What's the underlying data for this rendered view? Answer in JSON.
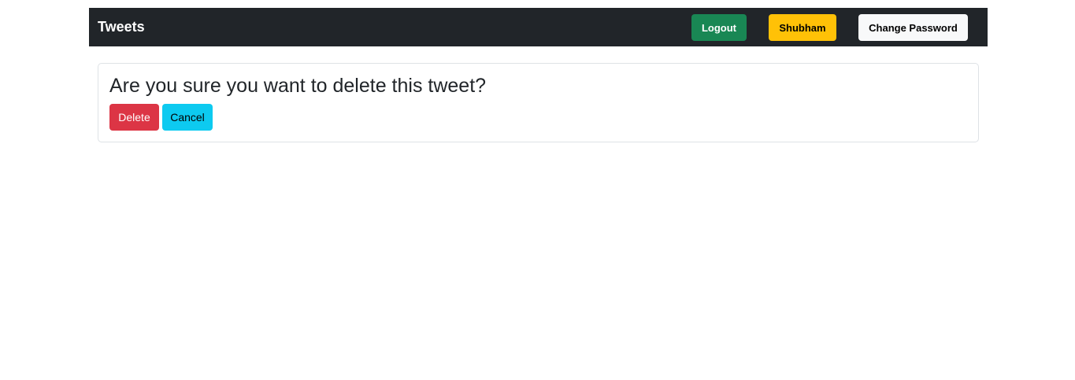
{
  "navbar": {
    "brand": "Tweets",
    "logout_label": "Logout",
    "username": "Shubham",
    "change_password_label": "Change Password"
  },
  "dialog": {
    "title": "Are you sure you want to delete this tweet?",
    "delete_label": "Delete",
    "cancel_label": "Cancel"
  },
  "colors": {
    "navbar_bg": "#212529",
    "logout": "#198754",
    "user": "#ffc107",
    "change_password": "#f8f9fa",
    "delete": "#dc3545",
    "cancel": "#0dcaf0"
  }
}
